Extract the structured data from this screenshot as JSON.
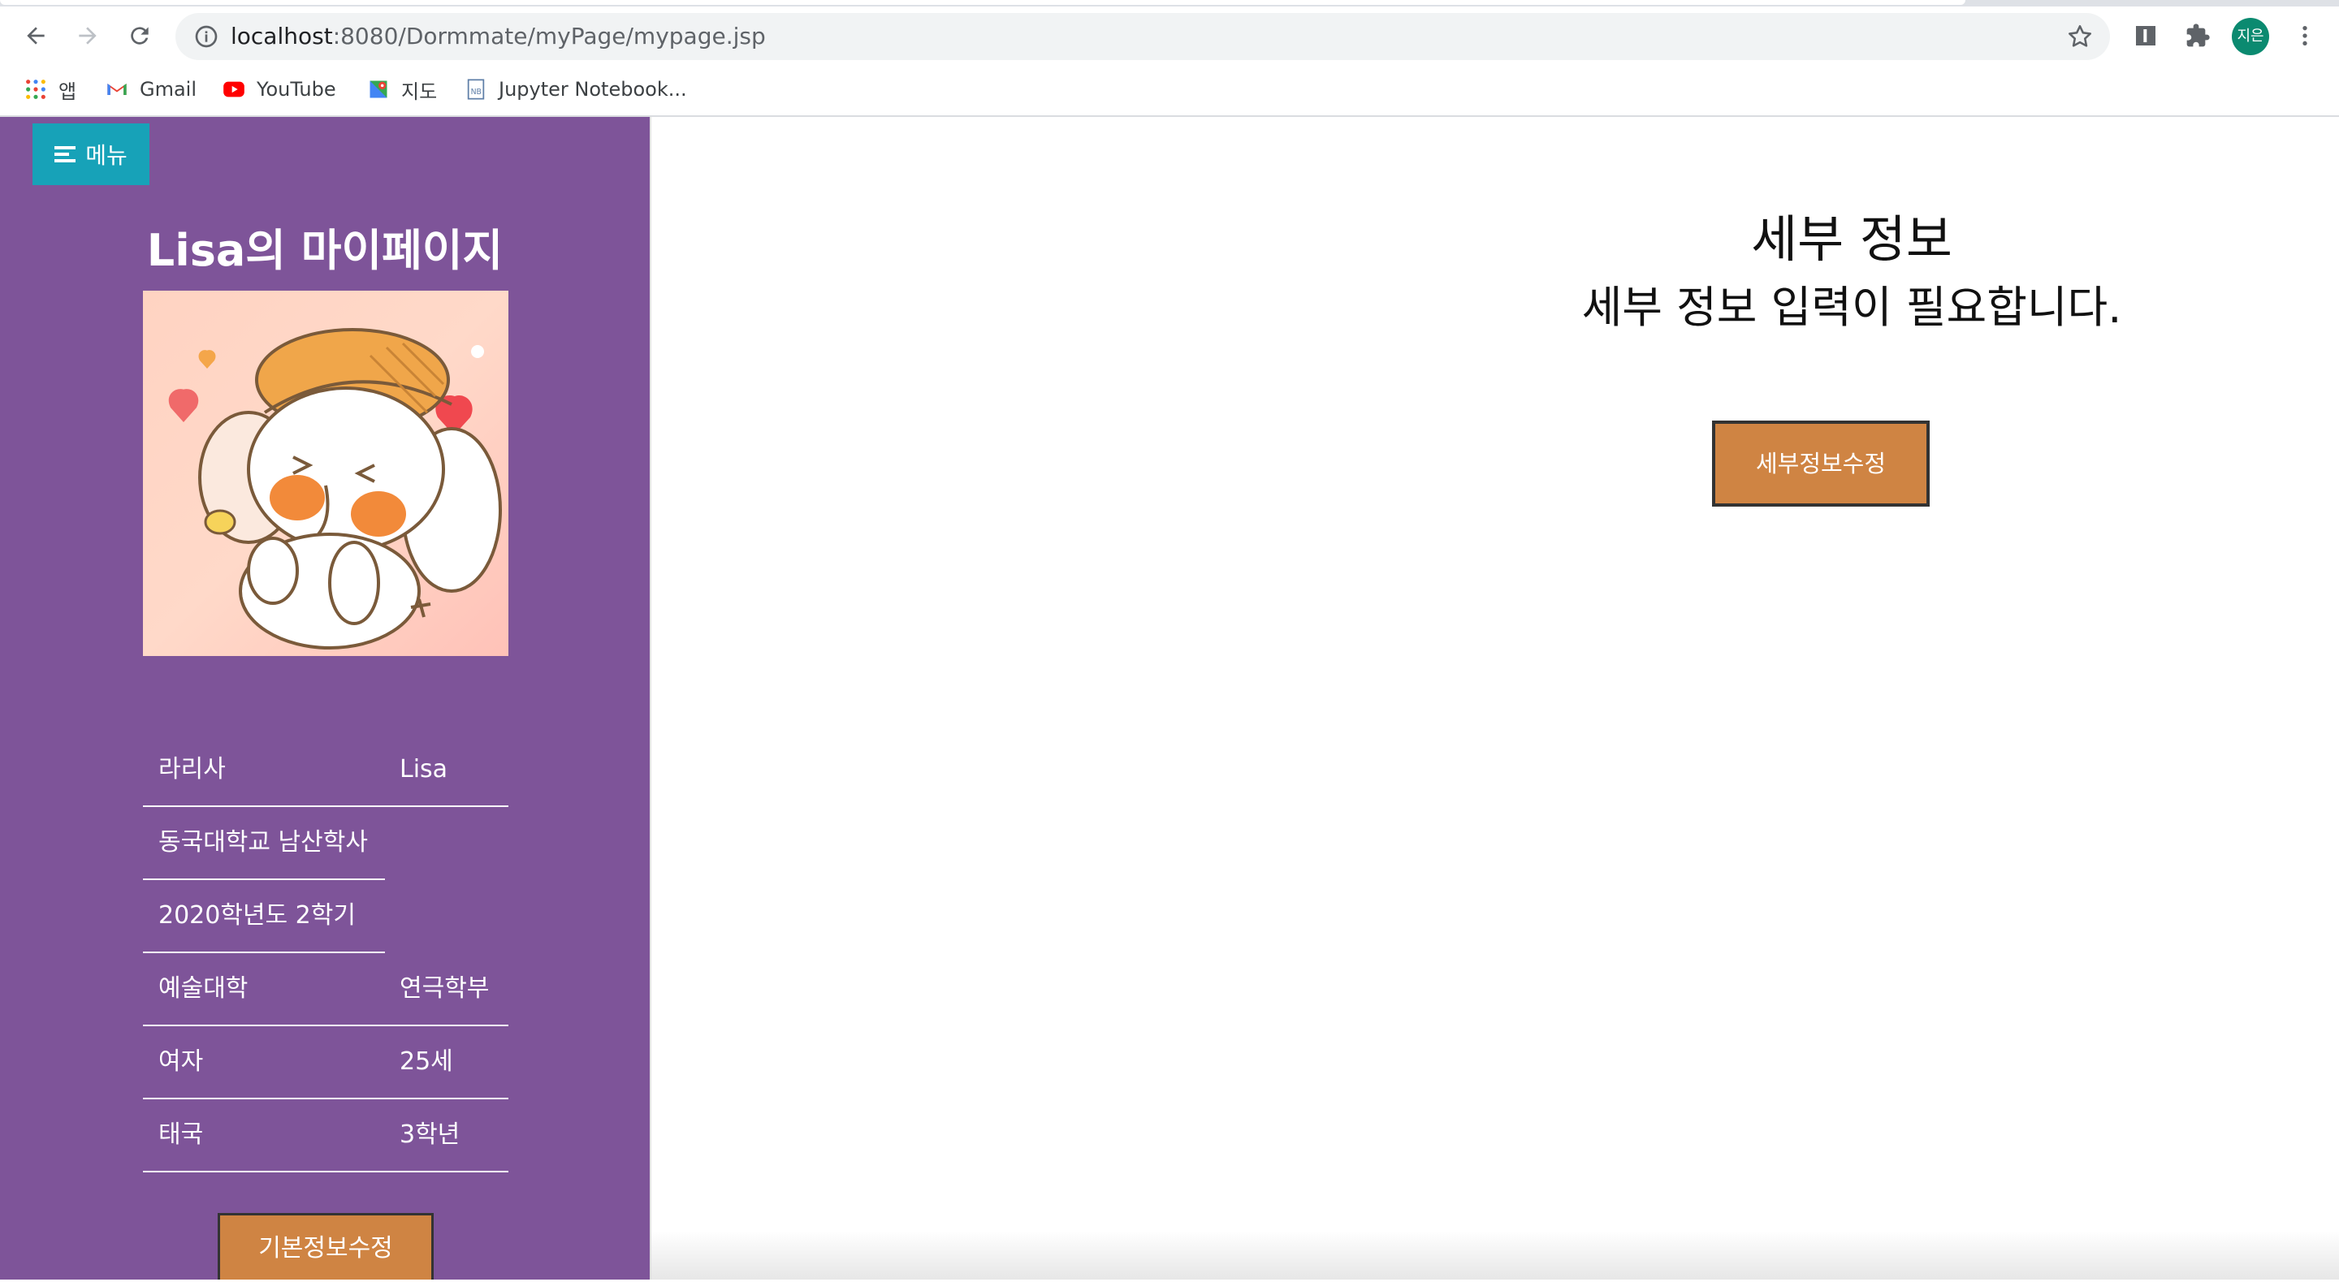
{
  "browser": {
    "url_host": "localhost",
    "url_rest": ":8080/Dormmate/myPage/mypage.jsp",
    "profile_initials": "지은",
    "bookmarks": [
      {
        "label": "앱",
        "icon": "apps-grid-icon"
      },
      {
        "label": "Gmail",
        "icon": "gmail-icon"
      },
      {
        "label": "YouTube",
        "icon": "youtube-icon"
      },
      {
        "label": "지도",
        "icon": "maps-icon"
      },
      {
        "label": "Jupyter Notebook...",
        "icon": "notebook-icon"
      }
    ]
  },
  "sidebar": {
    "menu_label": "메뉴",
    "title": "Lisa의 마이페이지",
    "rows": [
      {
        "left": "라리사",
        "right": "Lisa"
      },
      {
        "left": "동국대학교 남산학사",
        "right": ""
      },
      {
        "left": "2020학년도 2학기",
        "right": ""
      },
      {
        "left": "예술대학",
        "right": "연극학부"
      },
      {
        "left": "여자",
        "right": "25세"
      },
      {
        "left": "태국",
        "right": "3학년"
      }
    ],
    "edit_basic_label": "기본정보수정"
  },
  "main": {
    "title": "세부 정보",
    "subtitle": "세부 정보 입력이 필요합니다.",
    "edit_detail_label": "세부정보수정"
  },
  "colors": {
    "sidebar_bg": "#7e5499",
    "menu_button": "#17a2b8",
    "action_button": "#cf8443"
  }
}
